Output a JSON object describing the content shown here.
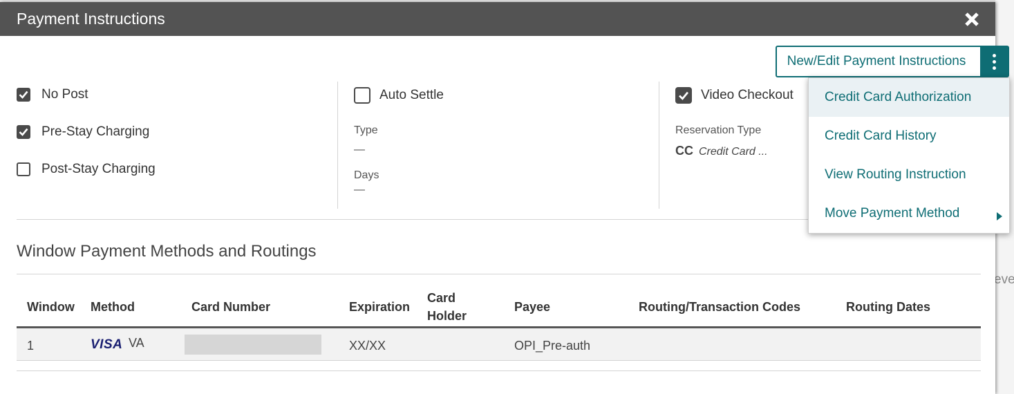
{
  "background": {
    "fragment_text": "eve"
  },
  "dialog": {
    "title": "Payment Instructions",
    "close_icon": "close-icon"
  },
  "toolbar": {
    "new_edit_label": "New/Edit Payment Instructions",
    "more_icon": "kebab-menu-icon"
  },
  "menu": {
    "items": [
      {
        "label": "Credit Card Authorization"
      },
      {
        "label": "Credit Card History"
      },
      {
        "label": "View Routing Instruction"
      },
      {
        "label": "Move Payment Method",
        "has_submenu": true
      }
    ]
  },
  "options": {
    "no_post": {
      "label": "No Post",
      "checked": true
    },
    "pre_stay": {
      "label": "Pre-Stay Charging",
      "checked": true
    },
    "post_stay": {
      "label": "Post-Stay Charging",
      "checked": false
    },
    "auto_settle": {
      "label": "Auto Settle",
      "checked": false
    },
    "video_checkout": {
      "label": "Video Checkout",
      "checked": true
    }
  },
  "settlement": {
    "type_label": "Type",
    "type_value": "—",
    "days_label": "Days",
    "days_value": "—"
  },
  "reservation": {
    "type_label": "Reservation Type",
    "code": "CC",
    "description": "Credit Card ..."
  },
  "routing_section": {
    "title": "Window Payment Methods and Routings",
    "columns": {
      "window": "Window",
      "method": "Method",
      "card_number": "Card Number",
      "expiration": "Expiration",
      "card_holder_line1": "Card",
      "card_holder_line2": "Holder",
      "payee": "Payee",
      "routing_codes": "Routing/Transaction Codes",
      "routing_dates": "Routing Dates"
    },
    "rows": [
      {
        "window": "1",
        "method_logo": "VISA",
        "method_code": "VA",
        "expiration": "XX/XX",
        "payee": "OPI_Pre-auth"
      }
    ]
  },
  "colors": {
    "accent": "#0e6d74",
    "title_bar": "#535353",
    "visa_blue": "#1a1f71"
  }
}
